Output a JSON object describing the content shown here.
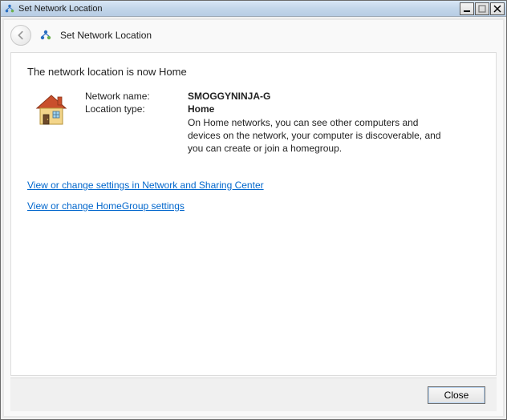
{
  "titlebar": {
    "title": "Set Network Location"
  },
  "header": {
    "title": "Set Network Location"
  },
  "main": {
    "headline": "The network location is now Home",
    "network_name_label": "Network name:",
    "network_name_value": "SMOGGYNINJA-G",
    "location_type_label": "Location type:",
    "location_type_value": "Home",
    "description": "On Home networks, you can see other computers and devices on the network, your computer is discoverable, and you can create or join a homegroup."
  },
  "links": {
    "network_sharing": "View or change settings in Network and Sharing Center",
    "homegroup": "View or change HomeGroup settings"
  },
  "footer": {
    "close_label": "Close"
  }
}
